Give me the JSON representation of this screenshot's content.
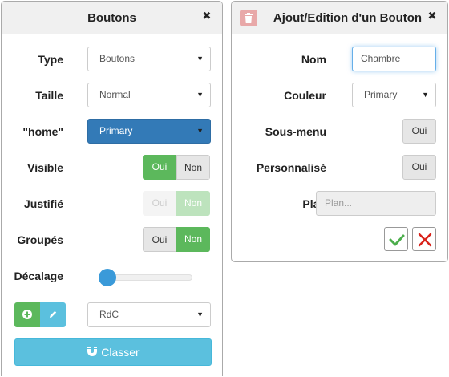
{
  "left_panel": {
    "title": "Boutons",
    "close_icon": "close-icon",
    "type": {
      "label": "Type",
      "value": "Boutons"
    },
    "taille": {
      "label": "Taille",
      "value": "Normal"
    },
    "home": {
      "label": "\"home\"",
      "value": "Primary"
    },
    "visible": {
      "label": "Visible",
      "on": "Oui",
      "off": "Non",
      "value": "Oui"
    },
    "justifie": {
      "label": "Justifié",
      "on": "Oui",
      "off": "Non",
      "value": "Non",
      "disabled": true
    },
    "groupes": {
      "label": "Groupés",
      "on": "Oui",
      "off": "Non",
      "value": "Non"
    },
    "decalage": {
      "label": "Décalage",
      "value": 0
    },
    "room_select": {
      "value": "RdC"
    },
    "classer_label": "Classer",
    "colors": {
      "primary": "#337ab7",
      "success": "#5cb85c",
      "info": "#5bc0de"
    }
  },
  "right_panel": {
    "title": "Ajout/Edition d'un Bouton",
    "nom": {
      "label": "Nom",
      "value": "Chambre"
    },
    "couleur": {
      "label": "Couleur",
      "value": "Primary"
    },
    "sous_menu": {
      "label": "Sous-menu",
      "button": "Oui"
    },
    "personnalise": {
      "label": "Personnalisé",
      "button": "Oui"
    },
    "plan": {
      "label": "Plan",
      "placeholder": "Plan..."
    },
    "confirm_icon": "check-icon",
    "cancel_icon": "cross-icon",
    "delete_icon": "trash-icon"
  }
}
